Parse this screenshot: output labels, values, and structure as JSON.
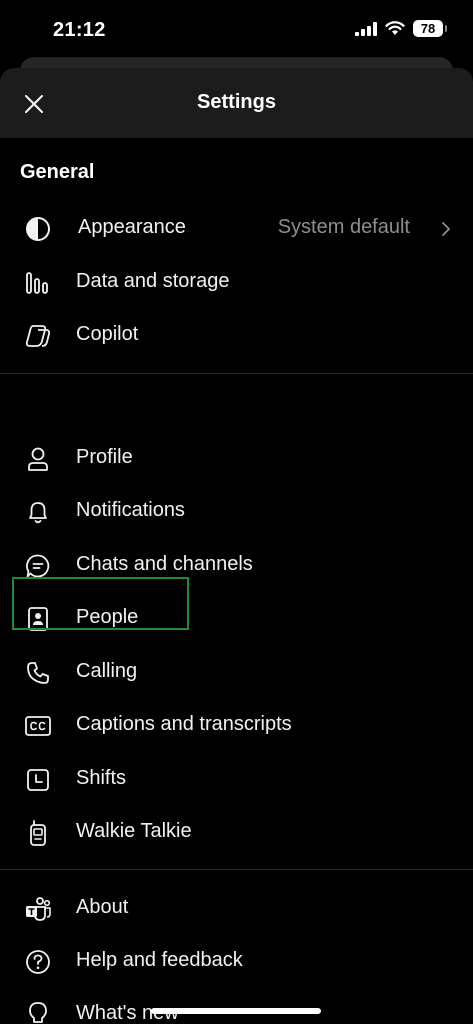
{
  "status_bar": {
    "time": "21:12",
    "battery": "78"
  },
  "header": {
    "title": "Settings",
    "close_icon": "close-icon"
  },
  "general": {
    "title": "General",
    "items": [
      {
        "label": "Appearance",
        "value": "System default",
        "icon": "contrast-icon"
      },
      {
        "label": "Data and storage",
        "icon": "bars-icon"
      },
      {
        "label": "Copilot",
        "icon": "copilot-icon"
      }
    ]
  },
  "account": {
    "items": [
      {
        "label": "Profile",
        "icon": "person-icon"
      },
      {
        "label": "Notifications",
        "icon": "bell-icon"
      },
      {
        "label": "Chats and channels",
        "icon": "chat-icon"
      },
      {
        "label": "People",
        "icon": "contact-card-icon"
      },
      {
        "label": "Calling",
        "icon": "phone-icon"
      },
      {
        "label": "Captions and transcripts",
        "icon": "closed-caption-icon"
      },
      {
        "label": "Shifts",
        "icon": "clock-icon"
      },
      {
        "label": "Walkie Talkie",
        "icon": "walkie-talkie-icon"
      }
    ]
  },
  "info": {
    "items": [
      {
        "label": "About",
        "icon": "teams-icon"
      },
      {
        "label": "Help and feedback",
        "icon": "help-icon"
      },
      {
        "label": "What's new",
        "icon": "lightbulb-icon"
      }
    ]
  },
  "colors": {
    "highlight": "#1f8a3a",
    "header_bg": "#1c1c1c",
    "secondary_text": "#8e8e8e"
  }
}
